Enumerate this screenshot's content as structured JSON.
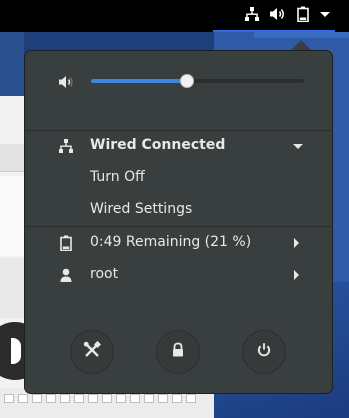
{
  "top_bar": {
    "indicators": [
      "network-wired-icon",
      "volume-high-icon",
      "battery-icon",
      "menu-arrow-down-icon"
    ]
  },
  "system_menu": {
    "volume": {
      "level_percent": 45,
      "icon": "volume-low-icon"
    },
    "network": {
      "label": "Wired Connected",
      "icon": "network-wired-icon",
      "items": [
        {
          "label": "Turn Off"
        },
        {
          "label": "Wired Settings"
        }
      ]
    },
    "battery": {
      "label": "0:49 Remaining (21 %)",
      "icon": "battery-icon"
    },
    "user": {
      "label": "root",
      "icon": "user-icon"
    },
    "buttons": [
      {
        "name": "settings-button",
        "icon": "settings-tools-icon"
      },
      {
        "name": "lock-button",
        "icon": "lock-icon"
      },
      {
        "name": "power-button",
        "icon": "power-icon"
      }
    ]
  },
  "colors": {
    "panel_bg": "#393f3f",
    "accent": "#3e86e0",
    "text": "#e8e8e8",
    "topbar": "#000000"
  }
}
